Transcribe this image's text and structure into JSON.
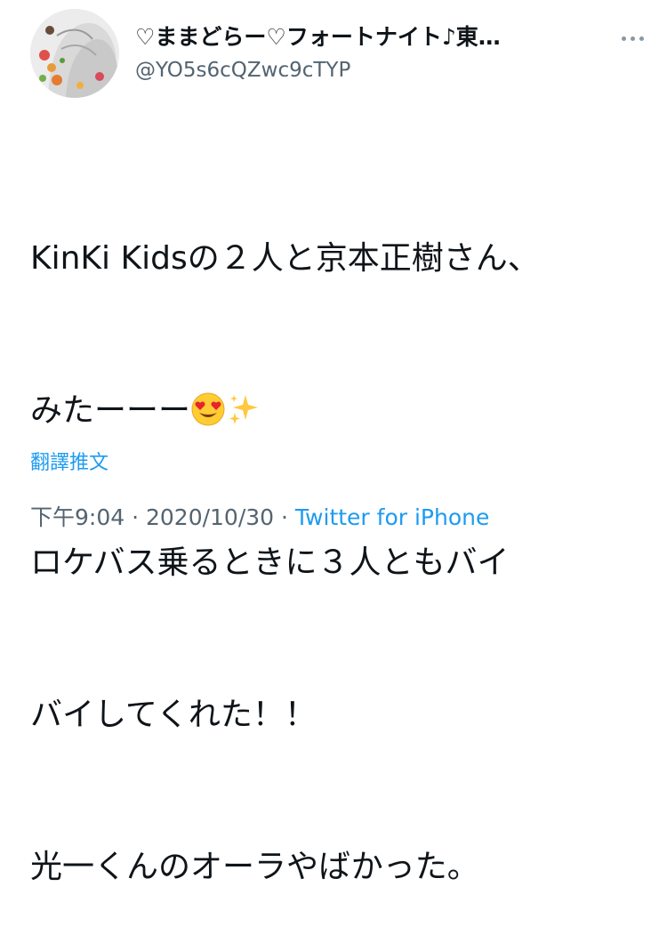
{
  "author": {
    "display_name": "♡ままどらー♡フォートナイト♪東…",
    "handle": "@YO5s6cQZwc9cTYP",
    "avatar_icon": "illustrated-portrait-avatar"
  },
  "tweet": {
    "line1": "KinKi Kidsの２人と京本正樹さん、",
    "line2_text": "みたーーー",
    "line2_emoji_1": "smiling-face-with-heart-eyes-emoji",
    "line2_emoji_2": "sparkles-emoji",
    "line3": "ロケバス乗るときに３人ともバイ",
    "line4": "バイしてくれた！！",
    "line5": "光一くんのオーラやばかった。"
  },
  "translate_label": "翻譯推文",
  "meta": {
    "time": "下午9:04",
    "sep1": " · ",
    "date": "2020/10/30",
    "sep2": " · ",
    "source": "Twitter for iPhone"
  },
  "colors": {
    "accent": "#1d9bf0",
    "secondary_text": "#536471",
    "primary_text": "#0f1419"
  }
}
